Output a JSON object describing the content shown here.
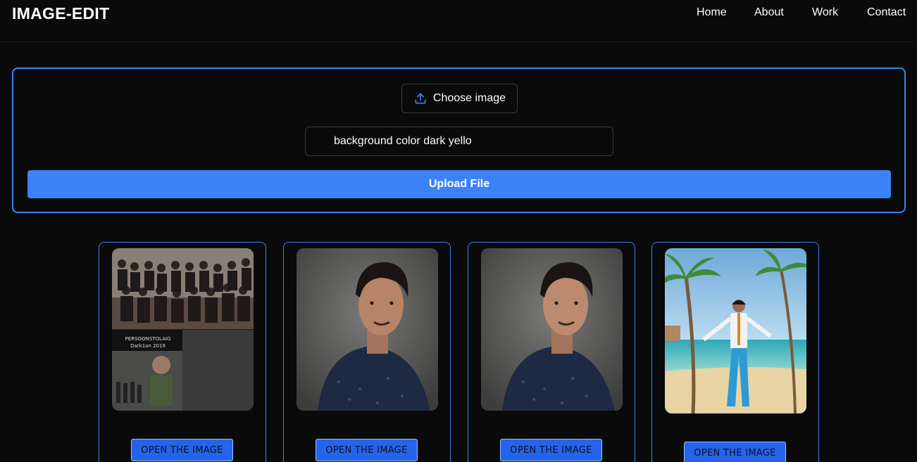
{
  "header": {
    "brand": "IMAGE-EDIT",
    "nav": [
      "Home",
      "About",
      "Work",
      "Contact"
    ]
  },
  "upload": {
    "choose_label": "Choose image",
    "choose_icon": "upload-icon",
    "prompt_value": "background color  dark yello",
    "submit_label": "Upload File"
  },
  "gallery": {
    "cards": [
      {
        "button_label": "OPEN THE IMAGE",
        "subject": "group-collage",
        "caption_lines": [
          "PERSOONSTOLAIG",
          "Dark1an 2019"
        ]
      },
      {
        "button_label": "OPEN THE IMAGE",
        "subject": "portrait-grey-bg"
      },
      {
        "button_label": "OPEN THE IMAGE",
        "subject": "portrait-grey-bg"
      },
      {
        "button_label": "OPEN THE IMAGE",
        "subject": "beach-palm-trees"
      }
    ]
  },
  "colors": {
    "background": "#0a0a0a",
    "accent": "#3b82f6",
    "button_blue": "#2563eb"
  }
}
